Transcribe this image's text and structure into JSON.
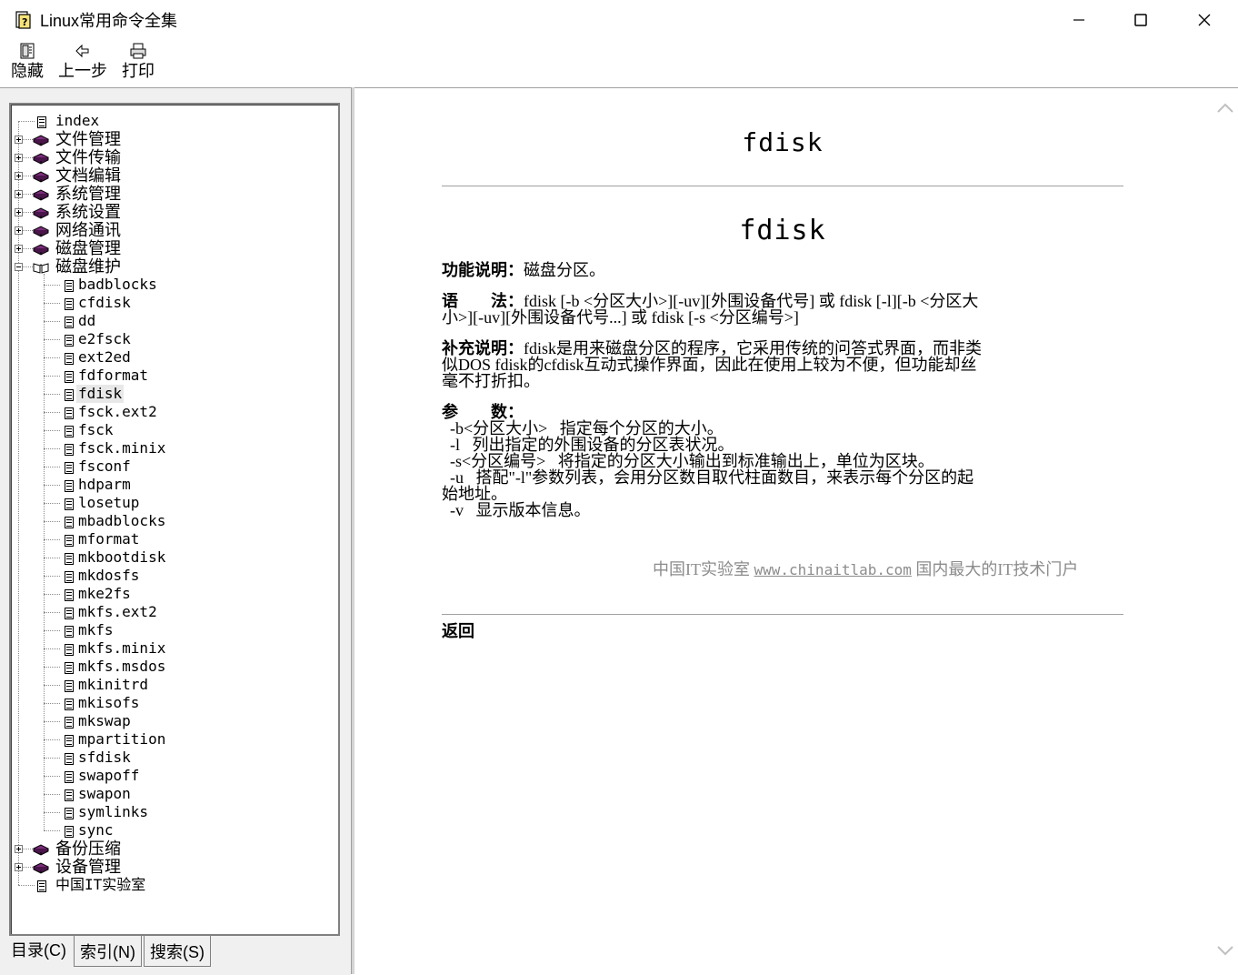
{
  "window": {
    "title": "Linux常用命令全集"
  },
  "toolbar": {
    "hide_label": "隐藏",
    "back_label": "上一步",
    "print_label": "打印"
  },
  "tree": {
    "items": [
      {
        "label": "index",
        "type": "doc",
        "level": 0
      },
      {
        "label": "文件管理",
        "type": "book",
        "level": 0
      },
      {
        "label": "文件传输",
        "type": "book",
        "level": 0
      },
      {
        "label": "文档编辑",
        "type": "book",
        "level": 0
      },
      {
        "label": "系统管理",
        "type": "book",
        "level": 0
      },
      {
        "label": "系统设置",
        "type": "book",
        "level": 0
      },
      {
        "label": "网络通讯",
        "type": "book",
        "level": 0
      },
      {
        "label": "磁盘管理",
        "type": "book",
        "level": 0
      },
      {
        "label": "磁盘维护",
        "type": "book-open",
        "level": 0
      },
      {
        "label": "badblocks",
        "type": "doc",
        "level": 1
      },
      {
        "label": "cfdisk",
        "type": "doc",
        "level": 1
      },
      {
        "label": "dd",
        "type": "doc",
        "level": 1
      },
      {
        "label": "e2fsck",
        "type": "doc",
        "level": 1
      },
      {
        "label": "ext2ed",
        "type": "doc",
        "level": 1
      },
      {
        "label": "fdformat",
        "type": "doc",
        "level": 1
      },
      {
        "label": "fdisk",
        "type": "doc",
        "level": 1,
        "selected": true
      },
      {
        "label": "fsck.ext2",
        "type": "doc",
        "level": 1
      },
      {
        "label": "fsck",
        "type": "doc",
        "level": 1
      },
      {
        "label": "fsck.minix",
        "type": "doc",
        "level": 1
      },
      {
        "label": "fsconf",
        "type": "doc",
        "level": 1
      },
      {
        "label": "hdparm",
        "type": "doc",
        "level": 1
      },
      {
        "label": "losetup",
        "type": "doc",
        "level": 1
      },
      {
        "label": "mbadblocks",
        "type": "doc",
        "level": 1
      },
      {
        "label": "mformat",
        "type": "doc",
        "level": 1
      },
      {
        "label": "mkbootdisk",
        "type": "doc",
        "level": 1
      },
      {
        "label": "mkdosfs",
        "type": "doc",
        "level": 1
      },
      {
        "label": "mke2fs",
        "type": "doc",
        "level": 1
      },
      {
        "label": "mkfs.ext2",
        "type": "doc",
        "level": 1
      },
      {
        "label": "mkfs",
        "type": "doc",
        "level": 1
      },
      {
        "label": "mkfs.minix",
        "type": "doc",
        "level": 1
      },
      {
        "label": "mkfs.msdos",
        "type": "doc",
        "level": 1
      },
      {
        "label": "mkinitrd",
        "type": "doc",
        "level": 1
      },
      {
        "label": "mkisofs",
        "type": "doc",
        "level": 1
      },
      {
        "label": "mkswap",
        "type": "doc",
        "level": 1
      },
      {
        "label": "mpartition",
        "type": "doc",
        "level": 1
      },
      {
        "label": "sfdisk",
        "type": "doc",
        "level": 1
      },
      {
        "label": "swapoff",
        "type": "doc",
        "level": 1
      },
      {
        "label": "swapon",
        "type": "doc",
        "level": 1
      },
      {
        "label": "symlinks",
        "type": "doc",
        "level": 1
      },
      {
        "label": "sync",
        "type": "doc",
        "level": 1
      },
      {
        "label": "备份压缩",
        "type": "book",
        "level": 0
      },
      {
        "label": "设备管理",
        "type": "book",
        "level": 0
      },
      {
        "label": "中国IT实验室",
        "type": "doc",
        "level": 0
      }
    ]
  },
  "tabs": {
    "contents": "目录(C)",
    "index": "索引(N)",
    "search": "搜索(S)"
  },
  "page": {
    "header": "fdisk",
    "title": "fdisk",
    "function_label": "功能说明：",
    "function_text": "磁盘分区。",
    "syntax_label": "语　　法：",
    "syntax_text": "fdisk [-b <分区大小>][-uv][外围设备代号] 或 fdisk [-l][-b <分区大小>][-uv][外围设备代号...] 或 fdisk [-s <分区编号>]",
    "desc_label": "补充说明：",
    "desc_text": "fdisk是用来磁盘分区的程序，它采用传统的问答式界面，而非类似DOS fdisk的cfdisk互动式操作界面，因此在使用上较为不便，但功能却丝毫不打折扣。",
    "params_label": "参　　数：",
    "params_text": "  -b<分区大小>   指定每个分区的大小。\n  -l   列出指定的外围设备的分区表状况。\n  -s<分区编号>   将指定的分区大小输出到标准输出上，单位为区块。\n  -u   搭配\"-l\"参数列表，会用分区数目取代柱面数目，来表示每个分区的起始地址。\n  -v   显示版本信息。",
    "footer_prefix": "中国IT实验室",
    "footer_site": "www.chinaitlab.com",
    "footer_suffix": "国内最大的IT技术门户",
    "back_link": "返回"
  },
  "colors": {
    "book": "#7b2c7b",
    "footer_text": "#8c8c8c",
    "pane_bg": "#f0f0f0"
  }
}
